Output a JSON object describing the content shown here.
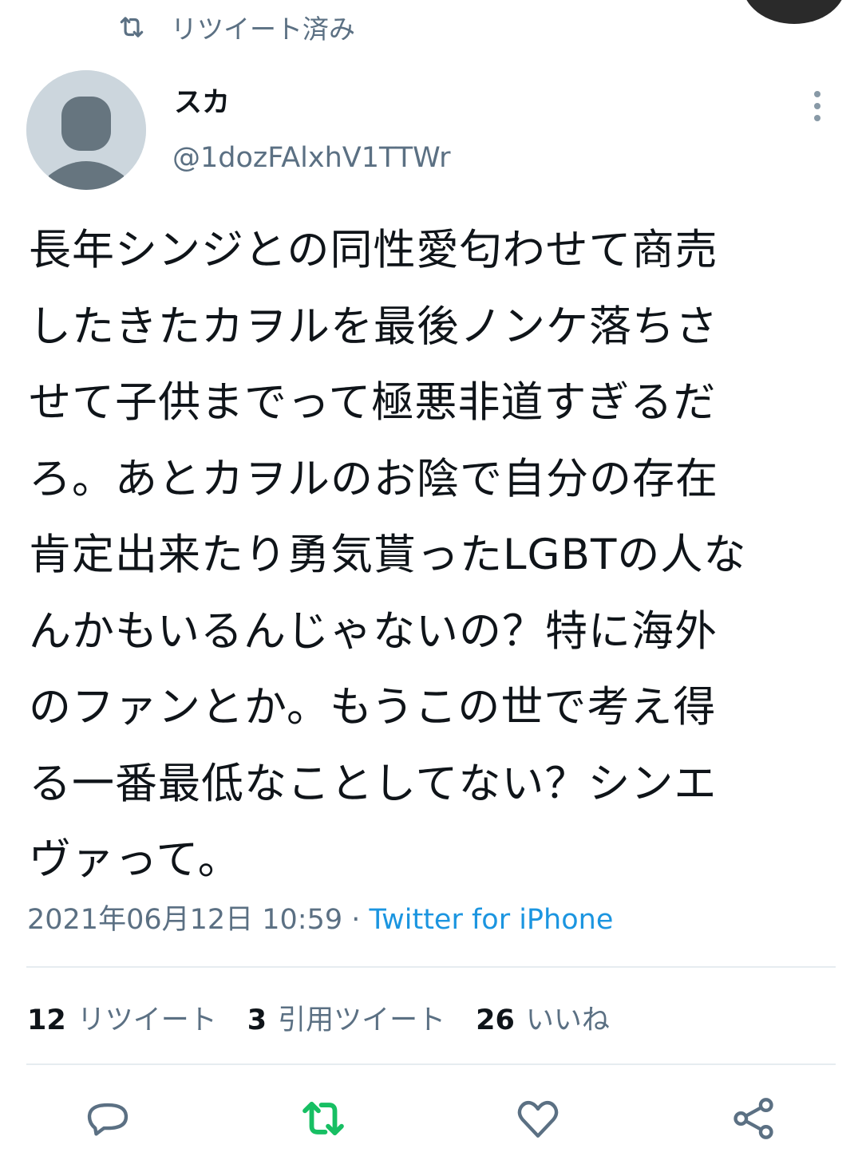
{
  "retweet_context": "リツイート済み",
  "user": {
    "display_name": "スカ",
    "handle": "@1dozFAlxhV1TTWr"
  },
  "tweet": {
    "text": "長年シンジとの同性愛匂わせて商売\nしたきたカヲルを最後ノンケ落ちさ\nせて子供までって極悪非道すぎるだ\nろ。あとカヲルのお陰で自分の存在\n肯定出来たり勇気貰ったLGBTの人な\nんかもいるんじゃないの？特に海外\nのファンとか。もうこの世で考え得\nる一番最低なことしてない？シンエ\nヴァって。",
    "timestamp": "2021年06月12日 10:59",
    "separator": " · ",
    "source": "Twitter for iPhone"
  },
  "stats": [
    {
      "count": "12",
      "label": "リツイート"
    },
    {
      "count": "3",
      "label": "引用ツイート"
    },
    {
      "count": "26",
      "label": "いいね"
    }
  ],
  "actions": {
    "reply_icon": "reply-icon",
    "retweet_icon": "retweet-icon",
    "retweet_active": true,
    "like_icon": "heart-icon",
    "share_icon": "share-icon"
  },
  "colors": {
    "secondary_text": "#5b7083",
    "link": "#1b95e0",
    "retweet_active": "#17bf63",
    "action_icon": "#5b7083",
    "divider": "#e6ecf0"
  }
}
